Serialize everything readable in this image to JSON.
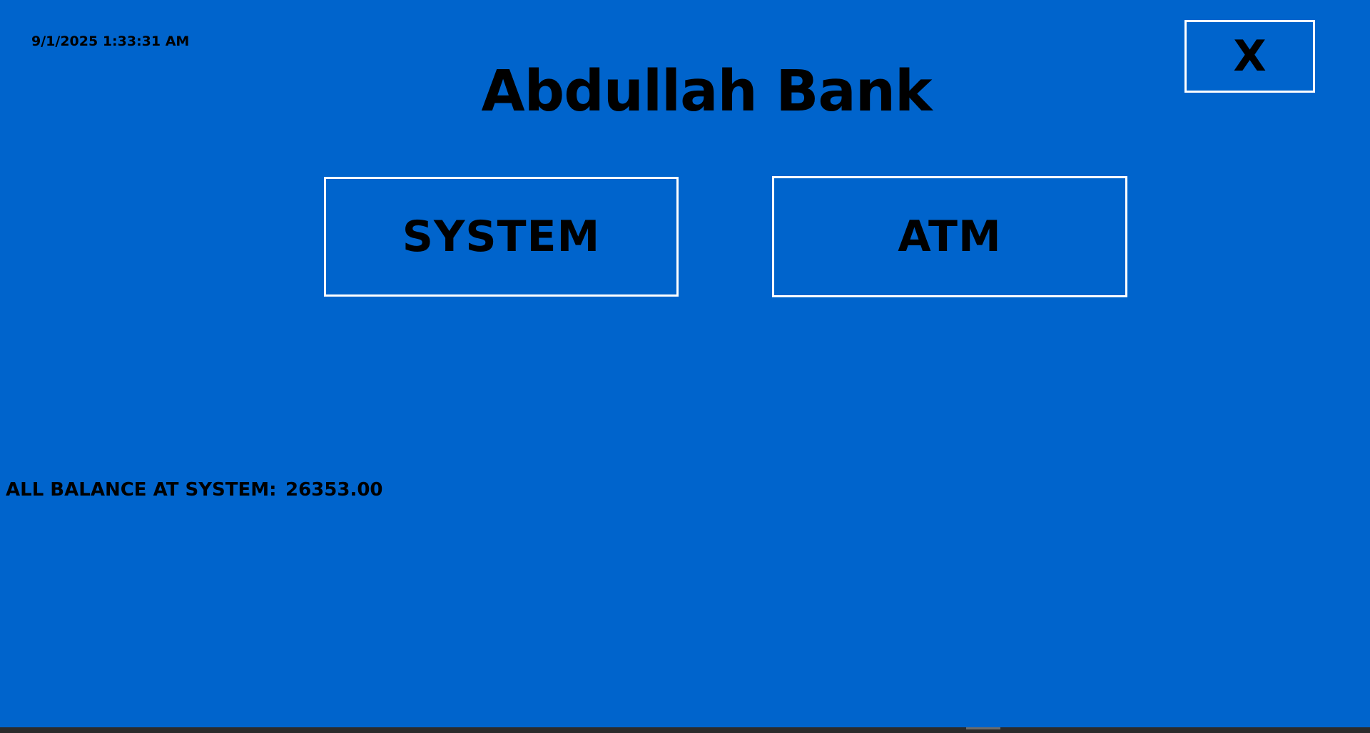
{
  "app": {
    "datetime": "9/1/2025 1:33:31 AM",
    "title": "Abdullah Bank",
    "close_label": "X"
  },
  "menu": {
    "system_label": "SYSTEM",
    "atm_label": "ATM"
  },
  "balance": {
    "label": "ALL BALANCE AT SYSTEM:",
    "value": "26353.00"
  },
  "colors": {
    "background": "#0064cc",
    "button_border": "#ffffff",
    "text": "#000000",
    "taskbar": "#2b2b2b"
  }
}
